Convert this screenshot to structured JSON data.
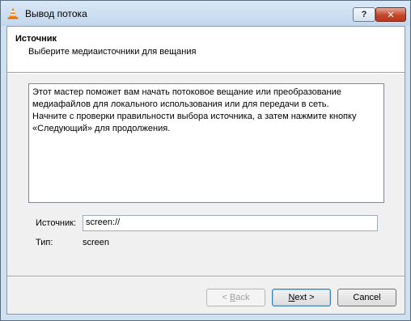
{
  "window": {
    "title": "Вывод потока"
  },
  "header": {
    "title": "Источник",
    "subtitle": "Выберите медиаисточники для вещания"
  },
  "description": {
    "line1": "Этот мастер поможет вам начать потоковое вещание или преобразование",
    "line2": "медиафайлов для локального использования или для передачи в сеть.",
    "line3": "Начните с проверки правильности выбора источника, а затем нажмите кнопку",
    "line4": "«Следующий» для продолжения."
  },
  "source": {
    "label": "Источник:",
    "value": "screen://"
  },
  "type": {
    "label": "Тип:",
    "value": "screen"
  },
  "buttons": {
    "back_underline": "B",
    "back_rest": "ack",
    "back_prefix": "< ",
    "next_underline": "N",
    "next_rest": "ext >",
    "cancel": "Cancel"
  },
  "titlebar_buttons": {
    "help": "?",
    "close": "✕"
  },
  "icons": {
    "app": "vlc-cone-icon"
  }
}
